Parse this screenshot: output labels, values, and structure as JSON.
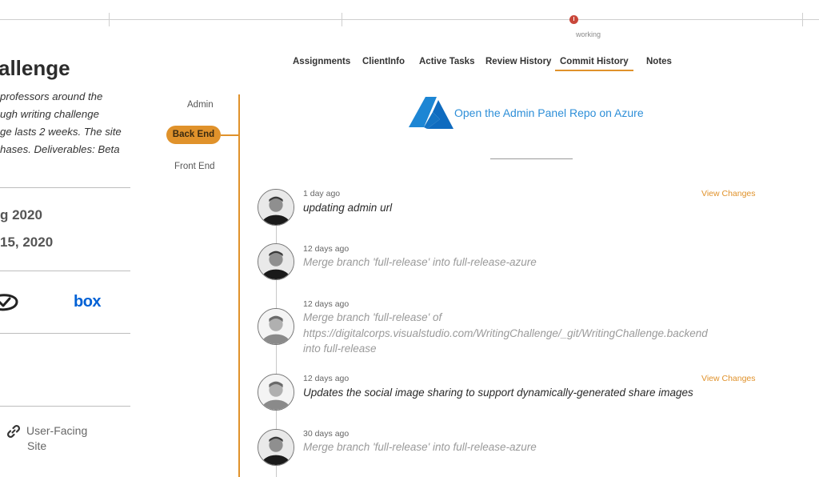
{
  "timeline": {
    "marker_label": "working"
  },
  "project": {
    "title": "allenge",
    "description_lines": [
      "professors around the",
      "ugh writing challenge",
      "ge lasts 2 weeks. The site",
      "hases. Deliverables: Beta"
    ],
    "date_start": "g 2020",
    "date_end": "15, 2020",
    "integrations": {
      "basecamp_icon": "checkmark-circle-icon",
      "box_label": "box"
    },
    "site_link": {
      "icon": "link-icon",
      "label_line1": "User-Facing",
      "label_line2": "Site"
    }
  },
  "tabs": [
    {
      "label": "Assignments"
    },
    {
      "label": "ClientInfo"
    },
    {
      "label": "Active Tasks"
    },
    {
      "label": "Review History"
    },
    {
      "label": "Commit History"
    },
    {
      "label": "Notes"
    }
  ],
  "active_tab": "Commit History",
  "subnav": {
    "admin": "Admin",
    "back_end": "Back End",
    "front_end": "Front End",
    "active": "Back End"
  },
  "repo": {
    "link_label": "Open the Admin Panel Repo on Azure",
    "logo_icon": "azure-logo-icon"
  },
  "commits": [
    {
      "time": "1 day ago",
      "message_lines": [
        "updating admin url"
      ],
      "style": "primary",
      "view_changes": "View Changes",
      "avatar": "dark"
    },
    {
      "time": "12 days ago",
      "message_lines": [
        "Merge branch 'full-release' into full-release-azure"
      ],
      "style": "muted",
      "view_changes": "",
      "avatar": "dark"
    },
    {
      "time": "12 days ago",
      "message_lines": [
        "Merge branch 'full-release' of",
        "https://digitalcorps.visualstudio.com/WritingChallenge/_git/WritingChallenge.backend",
        "into full-release"
      ],
      "style": "muted",
      "view_changes": "",
      "avatar": "light"
    },
    {
      "time": "12 days ago",
      "message_lines": [
        "Updates the social image sharing to support dynamically-generated share images"
      ],
      "style": "primary",
      "view_changes": "View Changes",
      "avatar": "light"
    },
    {
      "time": "30 days ago",
      "message_lines": [
        "Merge branch 'full-release' into full-release-azure"
      ],
      "style": "muted",
      "view_changes": "",
      "avatar": "dark"
    }
  ],
  "colors": {
    "accent": "#e0922b",
    "link": "#2e8fd8",
    "marker": "#c9473a"
  }
}
